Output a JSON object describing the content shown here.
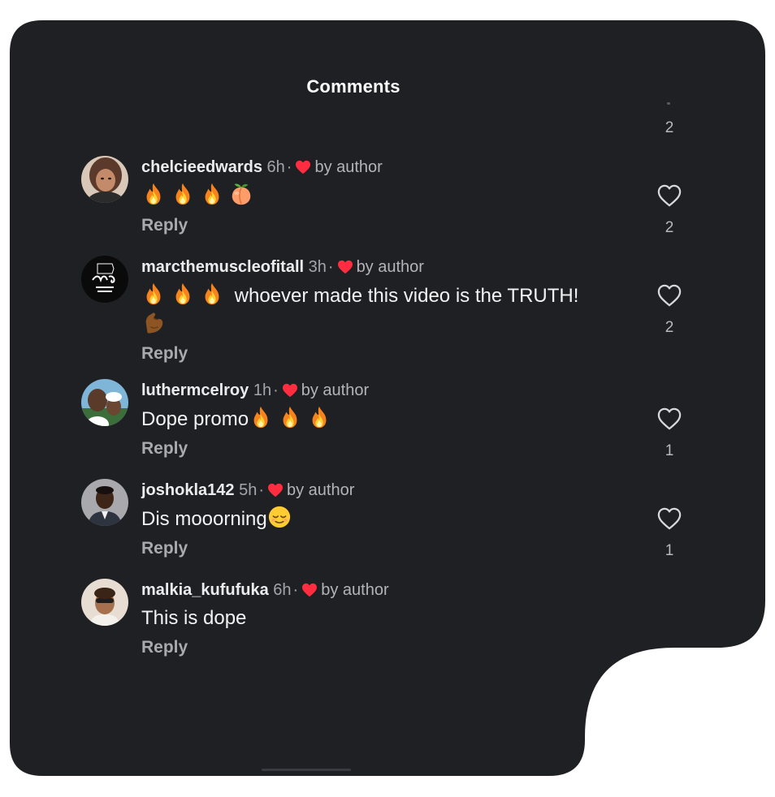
{
  "header": {
    "title": "Comments"
  },
  "top_like_count": "2",
  "colors": {
    "panel": "#1f2024",
    "text": "#f2f2f4",
    "muted": "#b3b3b8",
    "heart": "#ff2d3f"
  },
  "comments": [
    {
      "username": "chelcieedwards",
      "time": "6h",
      "liked_by": "by author",
      "text": "",
      "emojis": [
        "fire-icon",
        "fire-icon",
        "fire-icon",
        "peach-icon"
      ],
      "reply": "Reply",
      "likes": "2"
    },
    {
      "username": "marcthemuscleofitall",
      "time": "3h",
      "liked_by": "by author",
      "text": "whoever made this video is the TRUTH!",
      "emojis": [
        "fire-icon",
        "fire-icon",
        "fire-icon"
      ],
      "second_line_emoji": "flexed-biceps-icon",
      "reply": "Reply",
      "likes": "2"
    },
    {
      "username": "luthermcelroy",
      "time": "1h",
      "liked_by": "by author",
      "text": "Dope promo",
      "emojis": [
        "fire-icon",
        "fire-icon",
        "fire-icon"
      ],
      "reply": "Reply",
      "likes": "1"
    },
    {
      "username": "joshokla142",
      "time": "5h",
      "liked_by": "by author",
      "text": "Dis mooorning",
      "emojis": [
        "relieved-face-icon"
      ],
      "reply": "Reply",
      "likes": "1"
    },
    {
      "username": "malkia_kufufuka",
      "time": "6h",
      "liked_by": "by author",
      "text": "This is dope",
      "emojis": [],
      "reply": "Reply",
      "likes": ""
    }
  ]
}
